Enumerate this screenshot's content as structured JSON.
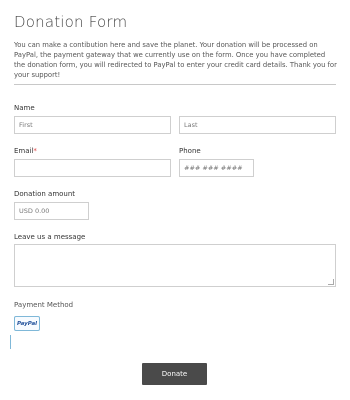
{
  "form": {
    "title": "Donation Form",
    "intro": "You can make a contibution here and save the planet. Your donation will be processed on PayPal, the payment gateway that we currently use on the form. Once you have completed the donation form, you will redirected to PayPal to enter your credit card details. Thank you for your support!"
  },
  "name": {
    "label": "Name",
    "first_placeholder": "First",
    "last_placeholder": "Last"
  },
  "email": {
    "label": "Email",
    "required_mark": "*",
    "value": ""
  },
  "phone": {
    "label": "Phone",
    "placeholder": "### ### ####"
  },
  "donation": {
    "label": "Donation amount",
    "value": "USD  0.00"
  },
  "message": {
    "label": "Leave us a message",
    "value": ""
  },
  "payment": {
    "label": "Payment Method",
    "option": "PayPal"
  },
  "submit": {
    "label": "Donate"
  },
  "colors": {
    "button_bg": "#4a4a4a",
    "required": "#e04040",
    "paypal_border": "#7fb8d8"
  }
}
